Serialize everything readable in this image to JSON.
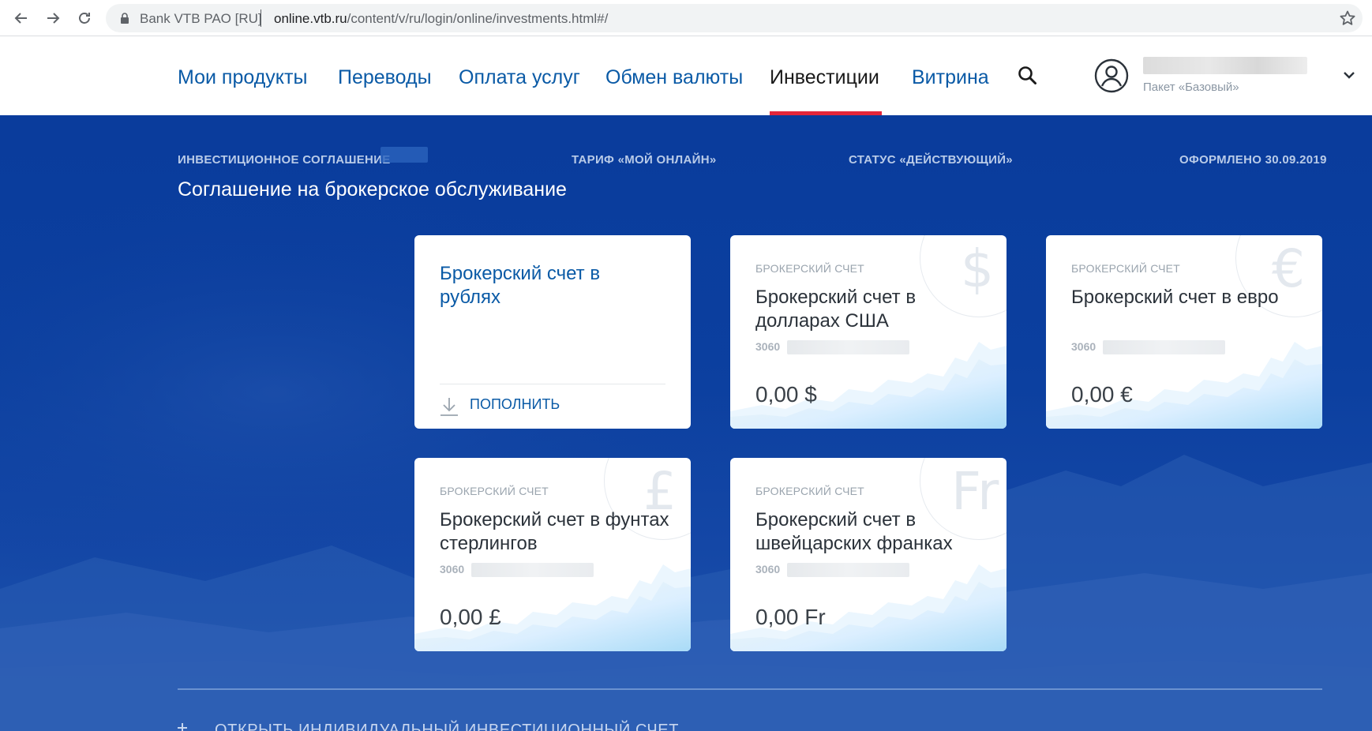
{
  "browser": {
    "site_name": "Bank VTB PAO [RU]",
    "url_host": "online.vtb.ru",
    "url_path": "/content/v/ru/login/online/investments.html#/"
  },
  "nav": {
    "items": [
      {
        "label": "Мои продукты"
      },
      {
        "label": "Переводы"
      },
      {
        "label": "Оплата услуг"
      },
      {
        "label": "Обмен валюты"
      },
      {
        "label": "Инвестиции",
        "active": true
      },
      {
        "label": "Витрина"
      }
    ]
  },
  "user": {
    "plan": "Пакет «Базовый»"
  },
  "agreement": {
    "label": "ИНВЕСТИЦИОННОЕ СОГЛАШЕНИЕ",
    "tariff": "ТАРИФ «МОЙ ОНЛАЙН»",
    "status": "СТАТУС «ДЕЙСТВУЮЩИЙ»",
    "issued": "ОФОРМЛЕНО 30.09.2019",
    "title": "Соглашение на брокерское обслуживание"
  },
  "cards": {
    "rub": {
      "title": "Брокерский счет в рублях",
      "action": "ПОПОЛНИТЬ"
    },
    "usd": {
      "label": "БРОКЕРСКИЙ СЧЕТ",
      "title": "Брокерский счет в долларах США",
      "account_prefix": "3060",
      "balance": "0,00 $",
      "symbol": "$"
    },
    "eur": {
      "label": "БРОКЕРСКИЙ СЧЕТ",
      "title": "Брокерский счет в евро",
      "account_prefix": "3060",
      "balance": "0,00 €",
      "symbol": "€"
    },
    "gbp": {
      "label": "БРОКЕРСКИЙ СЧЕТ",
      "title": "Брокерский счет в фунтах стерлингов",
      "account_prefix": "3060",
      "balance": "0,00 £",
      "symbol": "£"
    },
    "chf": {
      "label": "БРОКЕРСКИЙ СЧЕТ",
      "title": "Брокерский счет в швейцарских франках",
      "account_prefix": "3060",
      "balance": "0,00 Fr",
      "symbol": "Fr"
    }
  },
  "footer": {
    "open_iis": "ОТКРЫТЬ ИНДИВИДУАЛЬНЫЙ ИНВЕСТИЦИОННЫЙ СЧЕТ"
  },
  "colors": {
    "brand_blue": "#0a5aa6",
    "hero_blue": "#0a3c9c",
    "active_underline": "#e4263a"
  }
}
